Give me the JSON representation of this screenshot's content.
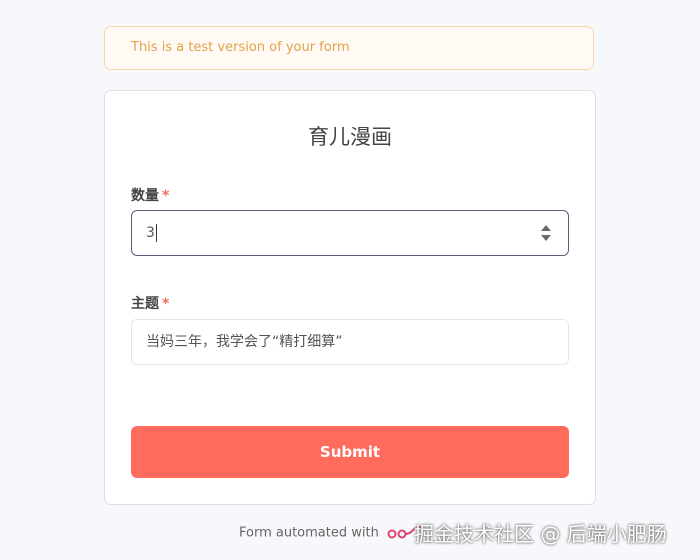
{
  "banner": {
    "text": "This is a test version of your form"
  },
  "form": {
    "title": "育儿漫画",
    "fields": [
      {
        "label": "数量",
        "required_mark": "*",
        "value": "3"
      },
      {
        "label": "主题",
        "required_mark": "*",
        "value": "当妈三年，我学会了“精打细算”"
      }
    ],
    "submit_label": "Submit"
  },
  "footer": {
    "text": "Form automated with"
  },
  "watermark": {
    "text": "掘金技术社区 @ 后端小肥肠"
  },
  "colors": {
    "accent": "#ff6b5c",
    "banner_text": "#e2a24a",
    "required": "#ef6e5c",
    "focus_border": "#5a5f7d"
  },
  "icons": {
    "stepper": "number-stepper-arrows-icon",
    "brand_logo": "chain-logo-icon"
  }
}
